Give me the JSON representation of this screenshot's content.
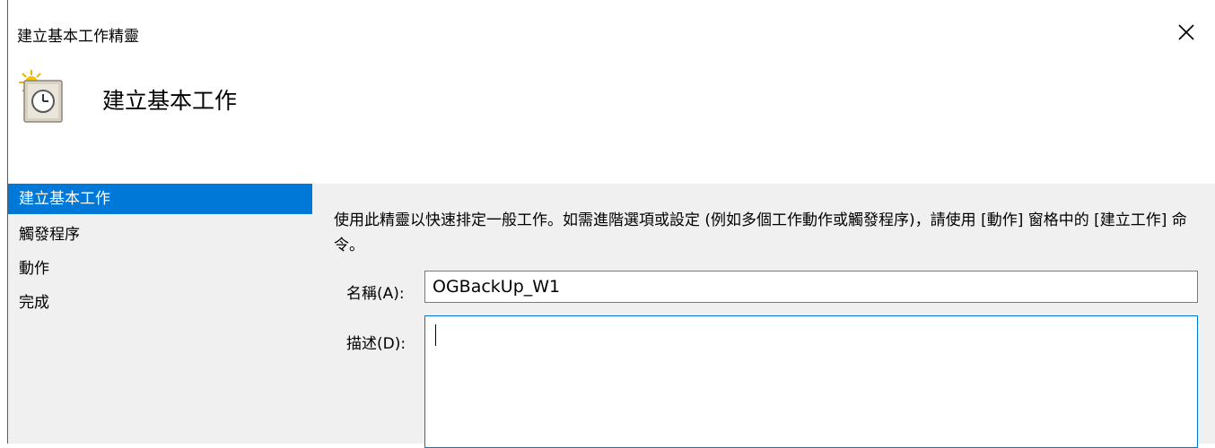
{
  "window": {
    "title": "建立基本工作精靈"
  },
  "header": {
    "title": "建立基本工作",
    "icon": "task-scheduler-clock-icon"
  },
  "sidebar": {
    "items": [
      {
        "label": "建立基本工作",
        "active": true
      },
      {
        "label": "觸發程序",
        "active": false
      },
      {
        "label": "動作",
        "active": false
      },
      {
        "label": "完成",
        "active": false
      }
    ]
  },
  "main": {
    "intro": "使用此精靈以快速排定一般工作。如需進階選項或設定 (例如多個工作動作或觸發程序)，請使用 [動作] 窗格中的 [建立工作] 命令。",
    "name_label": "名稱(A):",
    "name_value": "OGBackUp_W1",
    "desc_label": "描述(D):",
    "desc_value": ""
  },
  "colors": {
    "accent": "#0078d7",
    "panel": "#f0f0f0"
  }
}
